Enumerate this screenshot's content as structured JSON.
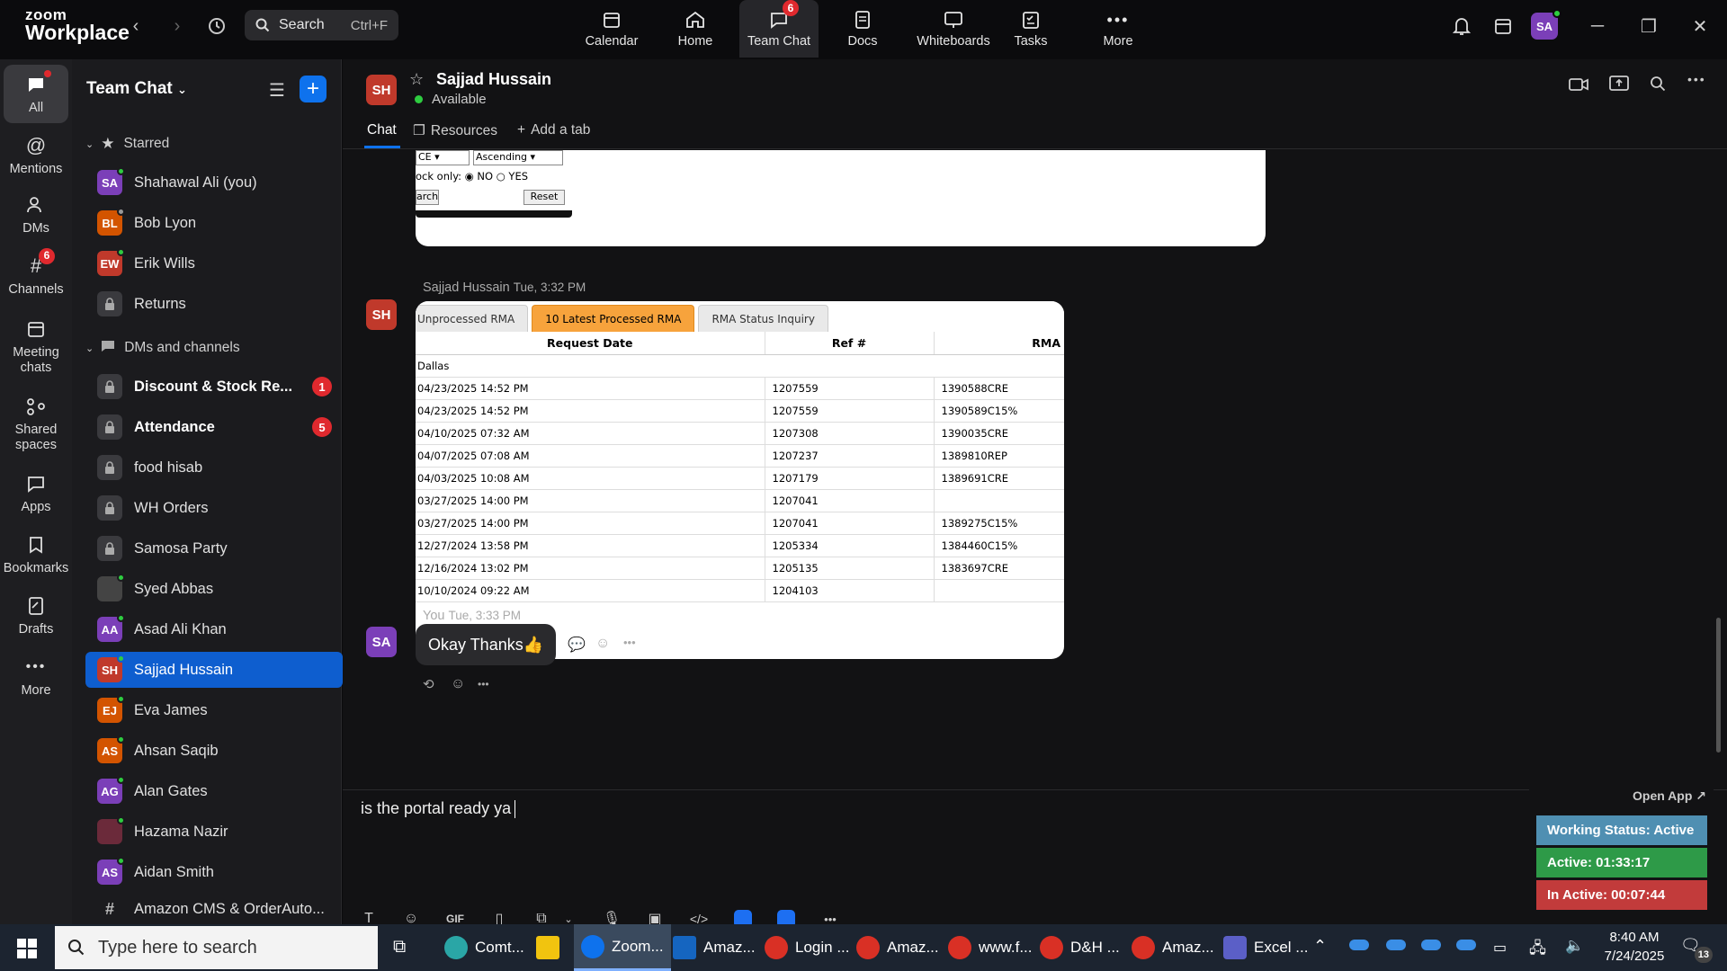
{
  "app": {
    "brand_line1": "zoom",
    "brand_line2": "Workplace"
  },
  "search": {
    "label": "Search",
    "shortcut": "Ctrl+F"
  },
  "topnav": [
    {
      "label": "Calendar",
      "icon": "calendar-icon"
    },
    {
      "label": "Home",
      "icon": "home-icon"
    },
    {
      "label": "Team Chat",
      "icon": "chat-icon",
      "badge": "6"
    },
    {
      "label": "Docs",
      "icon": "docs-icon"
    },
    {
      "label": "Whiteboards",
      "icon": "whiteboard-icon"
    },
    {
      "label": "Tasks",
      "icon": "tasks-icon"
    },
    {
      "label": "More",
      "icon": "more-icon"
    }
  ],
  "user_avatar": "SA",
  "rail": [
    {
      "label": "All"
    },
    {
      "label": "Mentions"
    },
    {
      "label": "DMs"
    },
    {
      "label": "Channels",
      "badge": "6"
    },
    {
      "label": "Meeting chats"
    },
    {
      "label": "Shared spaces"
    },
    {
      "label": "Apps"
    },
    {
      "label": "Bookmarks"
    },
    {
      "label": "Drafts"
    },
    {
      "label": "More"
    }
  ],
  "sidebar": {
    "title": "Team Chat",
    "starred_label": "Starred",
    "dms_label": "DMs and channels",
    "starred": [
      {
        "initials": "SA",
        "name": "Shahawal Ali (you)",
        "color": "#7b3fb8"
      },
      {
        "initials": "BL",
        "name": "Bob Lyon",
        "color": "#d35400"
      },
      {
        "initials": "EW",
        "name": "Erik Wills",
        "color": "#c0392b"
      },
      {
        "initials": "",
        "name": "Returns",
        "color": "#3a3a3e"
      }
    ],
    "channels": [
      {
        "name": "Discount & Stock Re...",
        "count": "1",
        "bold": true,
        "lock": true
      },
      {
        "name": "Attendance",
        "count": "5",
        "bold": true,
        "lock": true
      },
      {
        "name": "food hisab",
        "lock": true
      },
      {
        "name": "WH Orders",
        "lock": true
      },
      {
        "name": "Samosa Party",
        "lock": true
      },
      {
        "name": "Syed Abbas",
        "initials": "",
        "color": "#444"
      },
      {
        "name": "Asad Ali Khan",
        "initials": "AA",
        "color": "#7b3fb8"
      },
      {
        "name": "Sajjad Hussain",
        "initials": "SH",
        "color": "#c0392b",
        "selected": true
      },
      {
        "name": "Eva James",
        "initials": "EJ",
        "color": "#d35400"
      },
      {
        "name": "Ahsan Saqib",
        "initials": "AS",
        "color": "#d35400"
      },
      {
        "name": "Alan Gates",
        "initials": "AG",
        "color": "#7b3fb8"
      },
      {
        "name": "Hazama Nazir",
        "initials": "",
        "color": "#6b2a3a"
      },
      {
        "name": "Aidan Smith",
        "initials": "AS",
        "color": "#7b3fb8"
      },
      {
        "name": "Amazon CMS & OrderAuto...",
        "hash": true
      }
    ]
  },
  "chat": {
    "contact_initials": "SH",
    "contact_name": "Sajjad Hussain",
    "status": "Available",
    "tabs": {
      "chat": "Chat",
      "resources": "Resources",
      "add": "Add a tab"
    }
  },
  "messages": {
    "form_snip": {
      "select1": "CE",
      "select2": "Ascending",
      "stock_label": "ock only:",
      "no": "NO",
      "yes": "YES",
      "search_btn": "arch",
      "reset_btn": "Reset"
    },
    "msg2": {
      "sender": "Sajjad Hussain",
      "time": "Tue, 3:32 PM",
      "tabs": [
        "Unprocessed RMA",
        "10 Latest Processed RMA",
        "RMA Status Inquiry"
      ],
      "headers": [
        "Request Date",
        "Ref #",
        "RMA"
      ],
      "group": "Dallas",
      "rows": [
        [
          "04/23/2025 14:52 PM",
          "1207559",
          "1390588CRE"
        ],
        [
          "04/23/2025 14:52 PM",
          "1207559",
          "1390589C15%"
        ],
        [
          "04/10/2025 07:32 AM",
          "1207308",
          "1390035CRE"
        ],
        [
          "04/07/2025 07:08 AM",
          "1207237",
          "1389810REP"
        ],
        [
          "04/03/2025 10:08 AM",
          "1207179",
          "1389691CRE"
        ],
        [
          "03/27/2025 14:00 PM",
          "1207041",
          ""
        ],
        [
          "03/27/2025 14:00 PM",
          "1207041",
          "1389275C15%"
        ],
        [
          "12/27/2024 13:58 PM",
          "1205334",
          "1384460C15%"
        ],
        [
          "12/16/2024 13:02 PM",
          "1205135",
          "1383697CRE"
        ],
        [
          "10/10/2024 09:22 AM",
          "1204103",
          ""
        ]
      ]
    },
    "msg3": {
      "sender_initials": "SA",
      "sender": "You",
      "time": "Tue, 3:33 PM",
      "text": "Okay Thanks👍"
    }
  },
  "composer": {
    "text": "is the portal ready ya"
  },
  "work_status": {
    "open_app": "Open App ↗",
    "status": "Working Status: Active",
    "active": "Active: 01:33:17",
    "inactive": "In Active: 00:07:44"
  },
  "taskbar": {
    "search_placeholder": "Type here to search",
    "apps": [
      "Comt...",
      "",
      "Zoom...",
      "Amaz...",
      "Login ...",
      "Amaz...",
      "www.f...",
      "D&H ...",
      "Amaz...",
      "Excel ..."
    ],
    "time": "8:40 AM",
    "date": "7/24/2025",
    "notif": "13"
  }
}
